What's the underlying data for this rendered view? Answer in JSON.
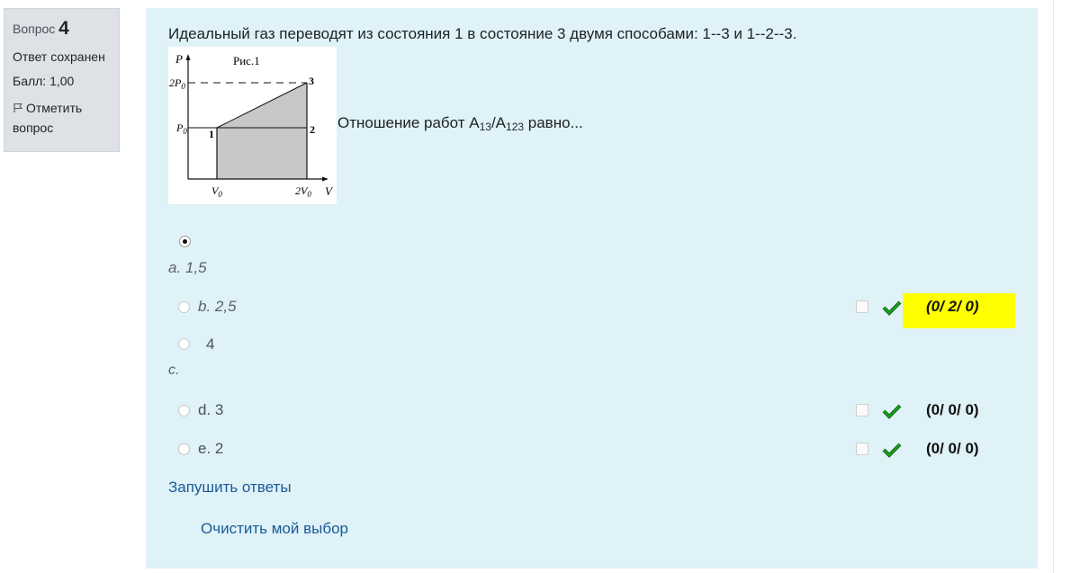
{
  "info": {
    "question_label": "Вопрос",
    "question_number": "4",
    "status": "Ответ сохранен",
    "grade": "Балл: 1,00",
    "flag_label": "Отметить вопрос"
  },
  "question": {
    "text": "Идеальный газ переводят из состояния 1 в состояние 3 двумя способами: 1--3 и 1--2--3.",
    "ratio_prefix": "Отношение работ А",
    "ratio_sub1": "13",
    "ratio_mid": "/А",
    "ratio_sub2": "123",
    "ratio_suffix": " равно..."
  },
  "figure": {
    "title": "Рис.1",
    "axis_p": "P",
    "axis_v": "V",
    "label_2p0": "2P",
    "label_p0": "P",
    "label_v0": "V",
    "label_2v0": "2V",
    "sub0": "0",
    "point1": "1",
    "point2": "2",
    "point3": "3"
  },
  "options": [
    {
      "letter": "a.",
      "text": "1,5",
      "selected": true
    },
    {
      "letter": "b.",
      "text": "2,5",
      "selected": false,
      "score": "(0/ 2/ 0)",
      "highlight": true
    },
    {
      "letter": "c.",
      "text": "4",
      "selected": false
    },
    {
      "letter": "d.",
      "text": "3",
      "selected": false,
      "score": "(0/ 0/ 0)"
    },
    {
      "letter": "e.",
      "text": "2",
      "selected": false,
      "score": "(0/ 0/ 0)"
    }
  ],
  "links": {
    "push_answers": "Запушить ответы",
    "clear_choice": "Очистить мой выбор"
  },
  "colors": {
    "panel": "#def2f8",
    "highlight": "#ffff00",
    "check": "#1aa31a",
    "link": "#1a5a96"
  }
}
